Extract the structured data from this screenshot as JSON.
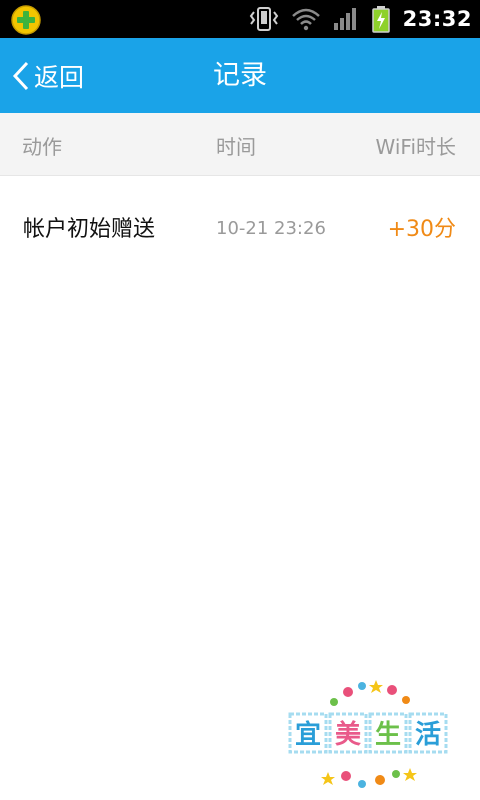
{
  "status_bar": {
    "time": "23:32",
    "icons": [
      "app-plus-icon",
      "vibrate-icon",
      "wifi-icon",
      "signal-icon",
      "battery-charging-icon"
    ]
  },
  "title_bar": {
    "back_label": "返回",
    "title": "记录",
    "background_color": "#1aa3e8"
  },
  "table": {
    "headers": {
      "action": "动作",
      "time": "时间",
      "wifi_duration": "WiFi时长"
    },
    "rows": [
      {
        "action": "帐户初始赠送",
        "time": "10-21 23:26",
        "points": "+30分"
      }
    ]
  },
  "watermark": {
    "chars": [
      "宜",
      "美",
      "生",
      "活"
    ]
  },
  "colors": {
    "accent": "#1aa3e8",
    "points": "#f08a16",
    "muted_text": "#9a9a9a"
  }
}
